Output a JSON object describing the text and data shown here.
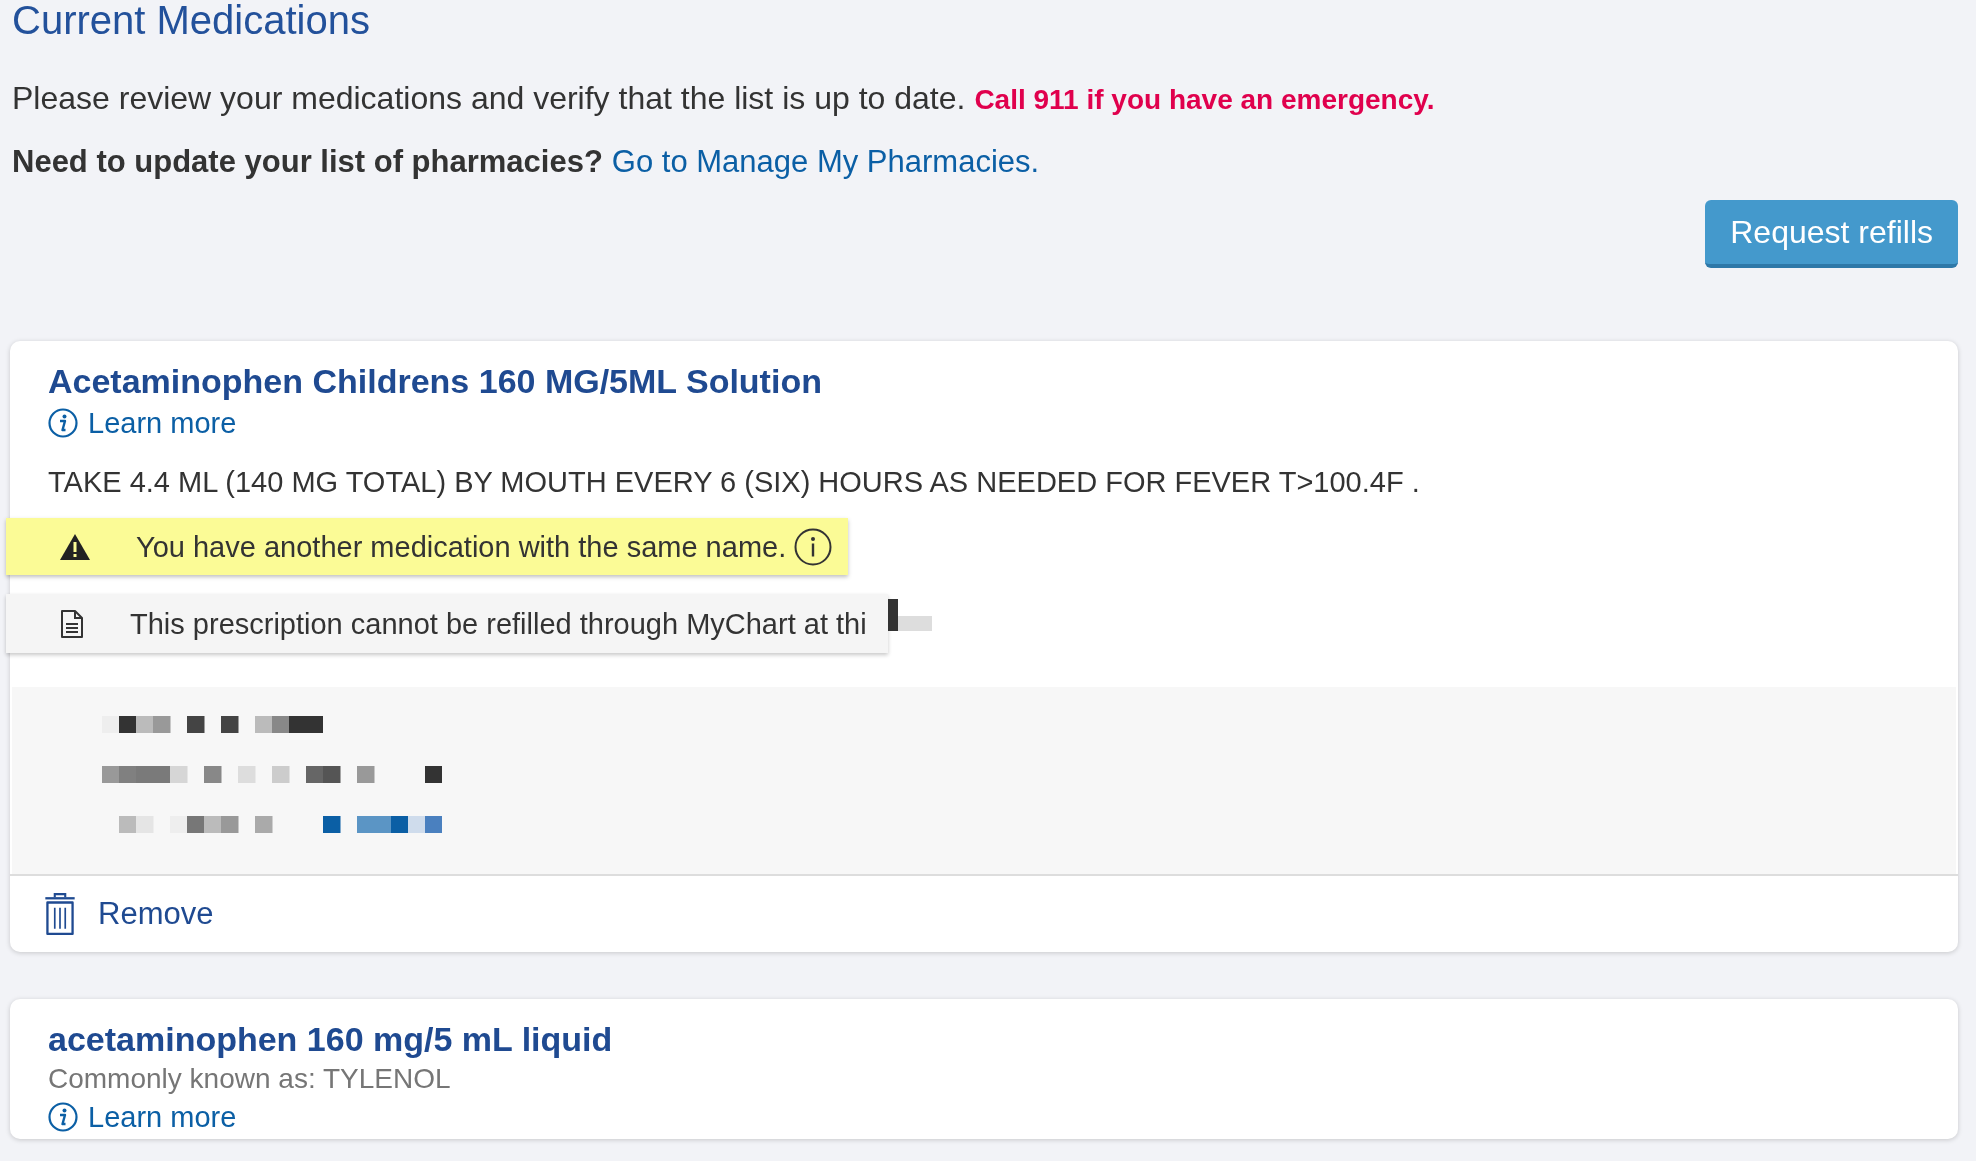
{
  "page": {
    "title": "Current Medications",
    "intro": "Please review your medications and verify that the list is up to date.",
    "emergency": "Call 911 if you have an emergency.",
    "pharmacy_prompt": "Need to update your list of pharmacies?",
    "pharmacy_link": "Go to Manage My Pharmacies."
  },
  "actions": {
    "request_refills": "Request refills"
  },
  "medications": [
    {
      "name": "Acetaminophen Childrens 160 MG/5ML Solution",
      "learn_more": "Learn more",
      "sig": "TAKE 4.4 ML (140 MG TOTAL) BY MOUTH EVERY 6 (SIX) HOURS AS NEEDED FOR FEVER T>100.4F .",
      "alerts": [
        {
          "kind": "warning",
          "text": "You have another medication with the same name."
        },
        {
          "kind": "note",
          "text": "This prescription cannot be refilled through MyChart at thi"
        }
      ],
      "details_redacted": true,
      "remove": "Remove"
    },
    {
      "name": "acetaminophen 160 mg/5 mL liquid",
      "common_name": "Commonly known as: TYLENOL",
      "learn_more": "Learn more"
    }
  ]
}
